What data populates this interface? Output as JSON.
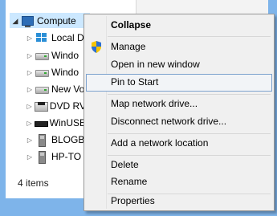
{
  "tree": {
    "root": {
      "label": "Compute",
      "expanded": true
    },
    "items": [
      {
        "label": "Local D",
        "icon": "windows-drive-icon"
      },
      {
        "label": "Windo",
        "icon": "hard-drive-icon"
      },
      {
        "label": "Windo",
        "icon": "hard-drive-icon"
      },
      {
        "label": "New Vo",
        "icon": "hard-drive-icon"
      },
      {
        "label": "DVD RV",
        "icon": "dvd-drive-icon"
      },
      {
        "label": "WinUSE",
        "icon": "usb-drive-icon"
      },
      {
        "label": "BLOGB",
        "icon": "usb-stick-icon"
      },
      {
        "label": "HP-TO",
        "icon": "usb-stick-icon"
      }
    ]
  },
  "status": {
    "items_count": "4 items"
  },
  "context_menu": {
    "items": [
      {
        "label": "Collapse",
        "bold": true
      },
      {
        "label": "Manage",
        "icon": "uac-shield-icon"
      },
      {
        "label": "Open in new window"
      },
      {
        "label": "Pin to Start",
        "highlighted": true
      },
      {
        "label": "Map network drive..."
      },
      {
        "label": "Disconnect network drive..."
      },
      {
        "label": "Add a network location"
      },
      {
        "label": "Delete"
      },
      {
        "label": "Rename"
      },
      {
        "label": "Properties"
      }
    ]
  },
  "colors": {
    "frame": "#7eb4ea",
    "selection": "#cce8ff",
    "menu_bg": "#f0f0f0",
    "menu_highlight_border": "#7da2ce"
  }
}
